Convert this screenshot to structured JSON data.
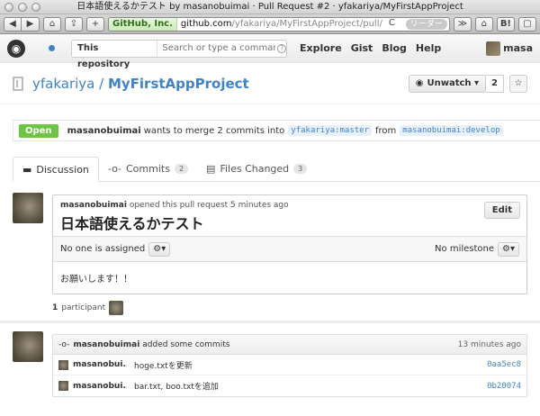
{
  "window": {
    "title": "日本語使えるかテスト by masanobuimai · Pull Request #2 · yfakariya/MyFirstAppProject"
  },
  "toolbar": {
    "back": "◀",
    "forward": "▶",
    "home": "⌂",
    "share": "⇪",
    "add": "+",
    "cert": "GitHub, Inc.",
    "url_host": "github.com",
    "url_path": "/yfakariya/MyFirstAppProject/pull/",
    "reload": "C",
    "reader": "リーダー",
    "ext1": "≫",
    "ext2": "⌂",
    "ext3": "B!",
    "ext4": "▢"
  },
  "gh": {
    "logo": "◉",
    "search_scope": "This repository",
    "search_placeholder": "Search or type a command",
    "search_help": "?",
    "nav": [
      "Explore",
      "Gist",
      "Blog",
      "Help"
    ],
    "user_short": "masa"
  },
  "repo": {
    "owner": "yfakariya",
    "sep": " / ",
    "name": "MyFirstAppProject",
    "watch_label": "Unwatch ▾",
    "watch_count": "2",
    "star": "☆"
  },
  "pr": {
    "status": "Open",
    "author": "masanobuimai",
    "merge_text": "wants to merge 2 commits into",
    "base": "yfakariya:master",
    "from": "from",
    "head": "masanobuimai:develop"
  },
  "tabs": [
    {
      "label": "Discussion",
      "icon": "▬"
    },
    {
      "label": "Commits",
      "count": "2",
      "icon": "-o-"
    },
    {
      "label": "Files Changed",
      "count": "3",
      "icon": "▤"
    }
  ],
  "discussion": {
    "author": "masanobuimai",
    "opened_text": "opened this pull request 5 minutes ago",
    "title": "日本語使えるかテスト",
    "edit": "Edit",
    "assignee": "No one is assigned",
    "milestone": "No milestone",
    "gear": "⚙▾",
    "body": "お願いします！！"
  },
  "participants": {
    "count": "1",
    "label": "participant"
  },
  "commits": {
    "author": "masanobuimai",
    "header_text": "added some commits",
    "time": "13 minutes ago",
    "rows": [
      {
        "author": "masanobui...",
        "message": "hoge.txtを更新",
        "sha": "0aa5ec8"
      },
      {
        "author": "masanobui...",
        "message": "bar.txt, boo.txtを追加",
        "sha": "0b20074"
      }
    ]
  }
}
